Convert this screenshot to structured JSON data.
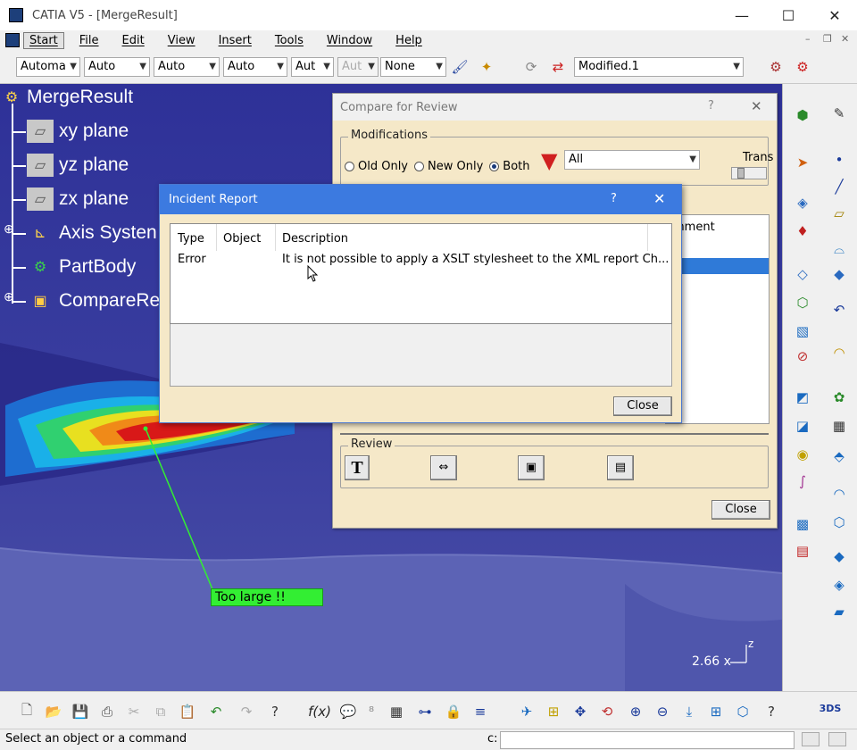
{
  "window": {
    "title": "CATIA V5 - [MergeResult]",
    "minimize": "—",
    "maximize": "☐",
    "close": "✕"
  },
  "menu": {
    "items": [
      "Start",
      "File",
      "Edit",
      "View",
      "Insert",
      "Tools",
      "Window",
      "Help"
    ],
    "mdi_min": "–",
    "mdi_restore": "❐",
    "mdi_close": "✕"
  },
  "toolbar": {
    "combos": [
      "Automa",
      "Auto",
      "Auto",
      "Auto",
      "Aut",
      "Aut",
      "None"
    ],
    "modified_combo": "Modified.1"
  },
  "tree": {
    "root": "MergeResult",
    "items": [
      "xy plane",
      "yz plane",
      "zx plane",
      "Axis Systen",
      "PartBody",
      "CompareRe"
    ]
  },
  "viewport": {
    "annotation": "Too large !!",
    "scale_value": "2.66",
    "axis_x": "x",
    "axis_z": "z"
  },
  "compare_dialog": {
    "title": "Compare for Review",
    "help": "?",
    "close_x": "✕",
    "modifications_label": "Modifications",
    "radios": [
      "Old Only",
      "New Only",
      "Both"
    ],
    "selected_radio": "Both",
    "filter_value": "All",
    "trans_label": "Trans",
    "comment_fragment": "mment",
    "review_label": "Review",
    "review_text_icon": "T",
    "close_button": "Close"
  },
  "incident_dialog": {
    "title": "Incident Report",
    "help": "?",
    "close_x": "✕",
    "columns": [
      "Type",
      "Object",
      "Description"
    ],
    "row": {
      "type": "Error",
      "object": "",
      "description": "It is not possible to apply a XSLT stylesheet to the XML report Ch..."
    },
    "close_button": "Close"
  },
  "status": {
    "message": "Select an object or a command",
    "prompt": "c:"
  },
  "colors": {
    "viewport": "#3b3f9e",
    "dialog_bg": "#f5e8c8",
    "accent": "#3c7ae0",
    "annotation": "#33ee33"
  }
}
